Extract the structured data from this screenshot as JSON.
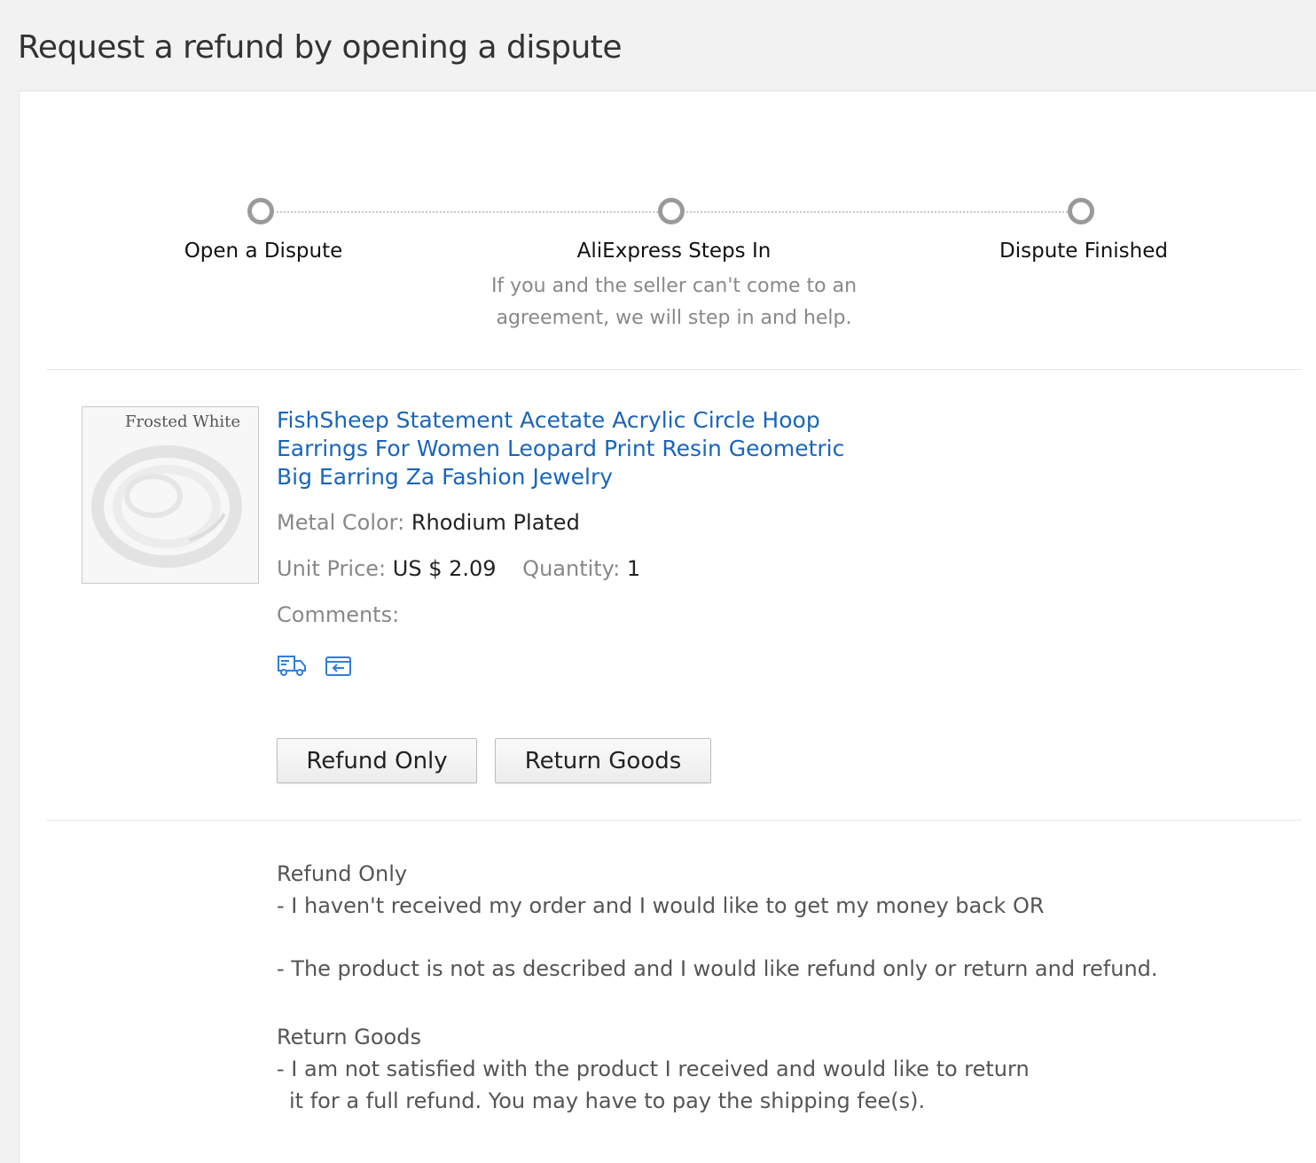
{
  "page": {
    "title": "Request a refund by opening a dispute"
  },
  "steps": [
    {
      "label": "Open a Dispute"
    },
    {
      "label": "AliExpress Steps In",
      "description_line1": "If you and the seller can't come to an",
      "description_line2": "agreement, we will step in and help."
    },
    {
      "label": "Dispute Finished"
    }
  ],
  "product": {
    "image_caption": "Frosted White",
    "title": "FishSheep Statement Acetate Acrylic Circle Hoop Earrings For Women Leopard Print Resin Geometric Big Earring Za Fashion Jewelry",
    "color_label": "Metal Color:",
    "color_value": "Rhodium Plated",
    "price_label": "Unit Price:",
    "price_value": "US $ 2.09",
    "quantity_label": "Quantity:",
    "quantity_value": "1",
    "comments_label": "Comments:",
    "icons": [
      "delivery-truck-icon",
      "return-box-icon"
    ]
  },
  "actions": {
    "refund_only": "Refund Only",
    "return_goods": "Return Goods"
  },
  "explanations": {
    "refund_heading": "Refund Only",
    "refund_line1": "- I haven't received my order and I would like to get my money back OR",
    "refund_line2": "- The product is not as described and I would like refund only or return and refund.",
    "return_heading": "Return Goods",
    "return_line1": "- I am not satisfied with the product I received and would like to return",
    "return_line2": "it for a full refund. You may have to pay the shipping fee(s)."
  },
  "colors": {
    "link": "#1a65b9",
    "muted": "#888888",
    "step_dot": "#9a9a9a",
    "icon": "#2f7ed8"
  }
}
